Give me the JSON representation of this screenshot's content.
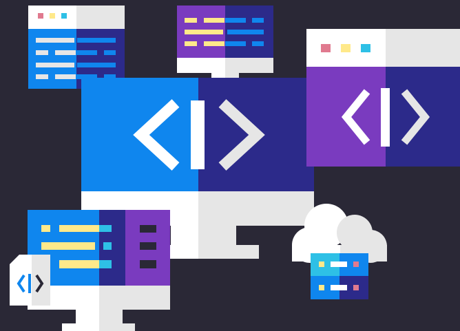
{
  "scene": {
    "description_visible_text": [],
    "icons": [
      "code-window-small-blue",
      "code-monitor-purple-top",
      "code-browser-window-purple",
      "code-monitor-large-center",
      "code-monitor-small-bottom-left",
      "code-file-icon",
      "cloud-server-icon"
    ]
  },
  "colors": {
    "background": "#2a2836",
    "blue": "#0f86ee",
    "navy": "#2c2a8a",
    "purple": "#7a3bbf",
    "light_gray": "#e6e6e6",
    "white": "#ffffff",
    "yellow": "#ffe98a",
    "pink": "#e07a8f",
    "cyan": "#2ec0e6"
  }
}
